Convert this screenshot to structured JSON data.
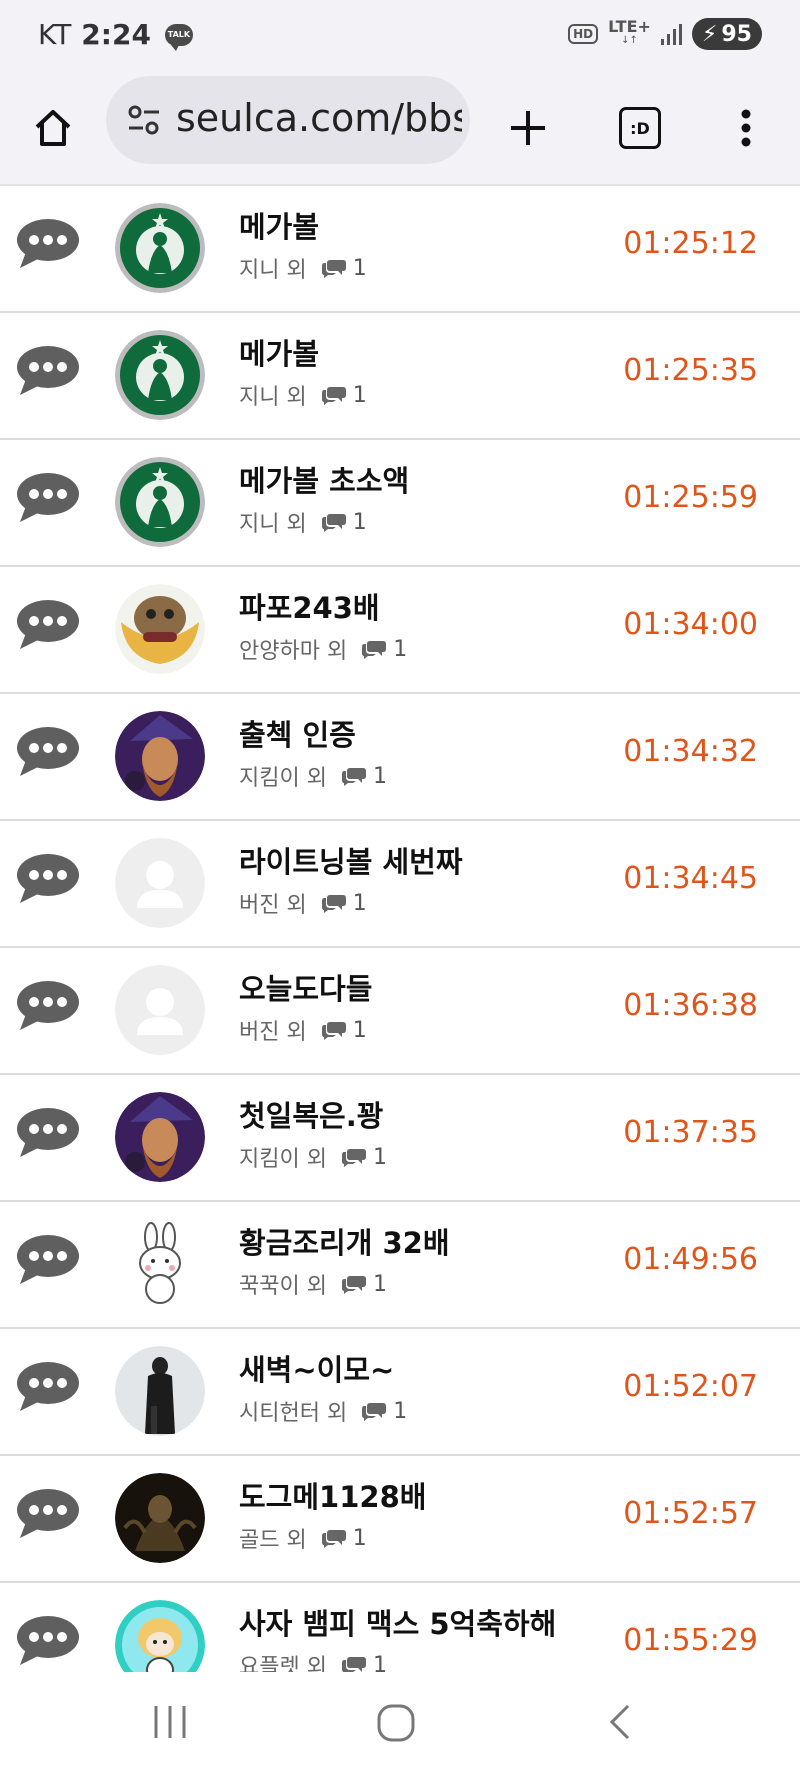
{
  "status_bar": {
    "carrier": "KT",
    "time": "2:24",
    "talk_badge": "TALK",
    "hd": "HD",
    "network": "LTE+",
    "battery": "95"
  },
  "browser": {
    "url": "seulca.com/bbs",
    "tab_label": ":D"
  },
  "posts": [
    {
      "title": "메가볼",
      "author": "지니 외",
      "comments": "1",
      "time": "01:25:12",
      "avatar": "starbucks"
    },
    {
      "title": "메가볼",
      "author": "지니 외",
      "comments": "1",
      "time": "01:25:35",
      "avatar": "starbucks"
    },
    {
      "title": "메가볼 초소액",
      "author": "지니 외",
      "comments": "1",
      "time": "01:25:59",
      "avatar": "starbucks"
    },
    {
      "title": "파포243배",
      "author": "안양하마 외",
      "comments": "1",
      "time": "01:34:00",
      "avatar": "cat"
    },
    {
      "title": "출첵 인증",
      "author": "지킴이 외",
      "comments": "1",
      "time": "01:34:32",
      "avatar": "wizard"
    },
    {
      "title": "라이트닝볼 세번짜",
      "author": "버진 외",
      "comments": "1",
      "time": "01:34:45",
      "avatar": "default"
    },
    {
      "title": "오늘도다들",
      "author": "버진 외",
      "comments": "1",
      "time": "01:36:38",
      "avatar": "default"
    },
    {
      "title": "첫일복은.꽝",
      "author": "지킴이 외",
      "comments": "1",
      "time": "01:37:35",
      "avatar": "wizard"
    },
    {
      "title": "황금조리개 32배",
      "author": "꾹꾹이 외",
      "comments": "1",
      "time": "01:49:56",
      "avatar": "bunny"
    },
    {
      "title": "새벽~이모~",
      "author": "시티헌터 외",
      "comments": "1",
      "time": "01:52:07",
      "avatar": "person"
    },
    {
      "title": "도그메1128배",
      "author": "골드 외",
      "comments": "1",
      "time": "01:52:57",
      "avatar": "dark"
    },
    {
      "title": "사자 뱀피 맥스 5억축하해",
      "author": "요플렛 외",
      "comments": "1",
      "time": "01:55:29",
      "avatar": "girl"
    }
  ],
  "colors": {
    "time": "#e0561a",
    "bubble_icon": "#5f5f5f",
    "toolbar_bg": "#f3f3f7"
  }
}
